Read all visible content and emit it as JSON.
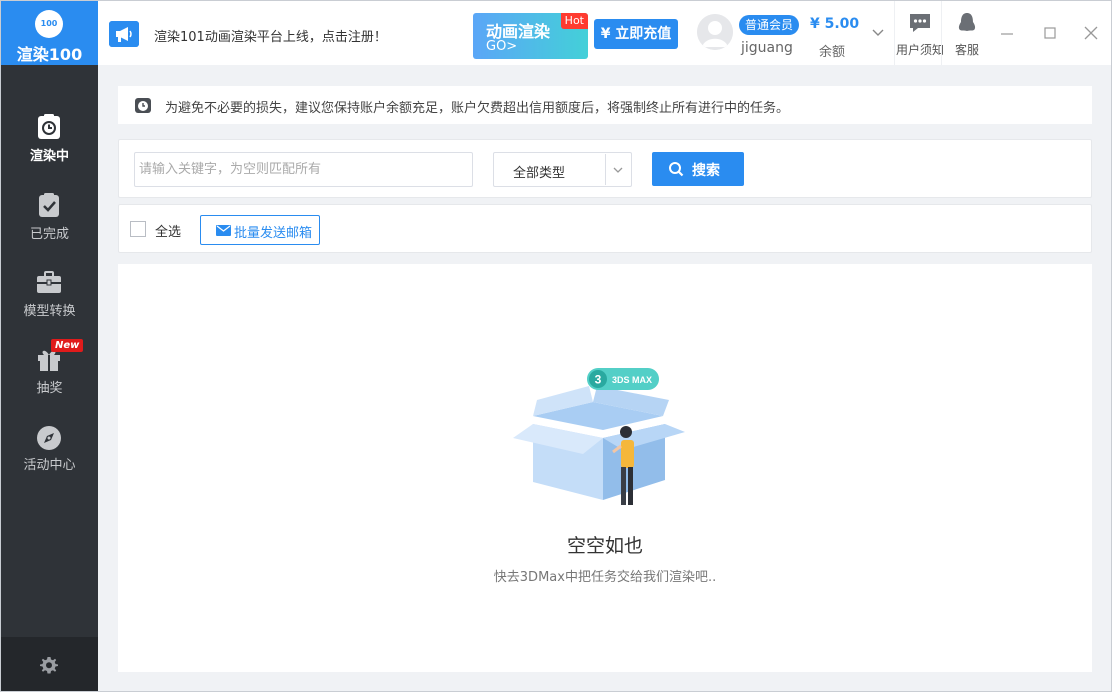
{
  "app": {
    "logo_badge": "100",
    "logo_text": "渲染100"
  },
  "sidebar": {
    "items": [
      {
        "label": "渲染中",
        "icon": "rendering-clock-icon",
        "active": true
      },
      {
        "label": "已完成",
        "icon": "completed-check-icon",
        "active": false
      },
      {
        "label": "模型转换",
        "icon": "briefcase-icon",
        "active": false
      },
      {
        "label": "抽奖",
        "icon": "gift-icon",
        "active": false,
        "badge": "New"
      },
      {
        "label": "活动中心",
        "icon": "compass-icon",
        "active": false
      }
    ],
    "settings_icon": "gear-icon"
  },
  "header": {
    "announcement": "渲染101动画渲染平台上线，点击注册！",
    "promo": {
      "title": "动画渲染",
      "go": "GO>",
      "hot": "Hot"
    },
    "recharge_label": "¥ 立即充值",
    "member_badge": "普通会员",
    "username": "jiguang",
    "balance": "¥ 5.00",
    "balance_label": "余额",
    "tools": [
      {
        "label": "用户须知",
        "icon": "chat-icon"
      },
      {
        "label": "客服",
        "icon": "customer-service-icon"
      }
    ]
  },
  "notice": {
    "text": "为避免不必要的损失，建议您保持账户余额充足，账户欠费超出信用额度后，将强制终止所有进行中的任务。"
  },
  "search": {
    "placeholder": "请输入关键字，为空则匹配所有",
    "value": "",
    "type_selected": "全部类型",
    "button_label": "搜索"
  },
  "actions": {
    "select_all_label": "全选",
    "batch_email_label": "批量发送邮箱"
  },
  "empty_state": {
    "badge": "3DS MAX",
    "badge_num": "3",
    "title": "空空如也",
    "subtitle": "快去3DMax中把任务交给我们渲染吧.."
  },
  "colors": {
    "primary": "#2a8cf0",
    "sidebar_bg": "#2f3338",
    "hot_red": "#ff3b30",
    "new_red": "#e01b1b"
  }
}
